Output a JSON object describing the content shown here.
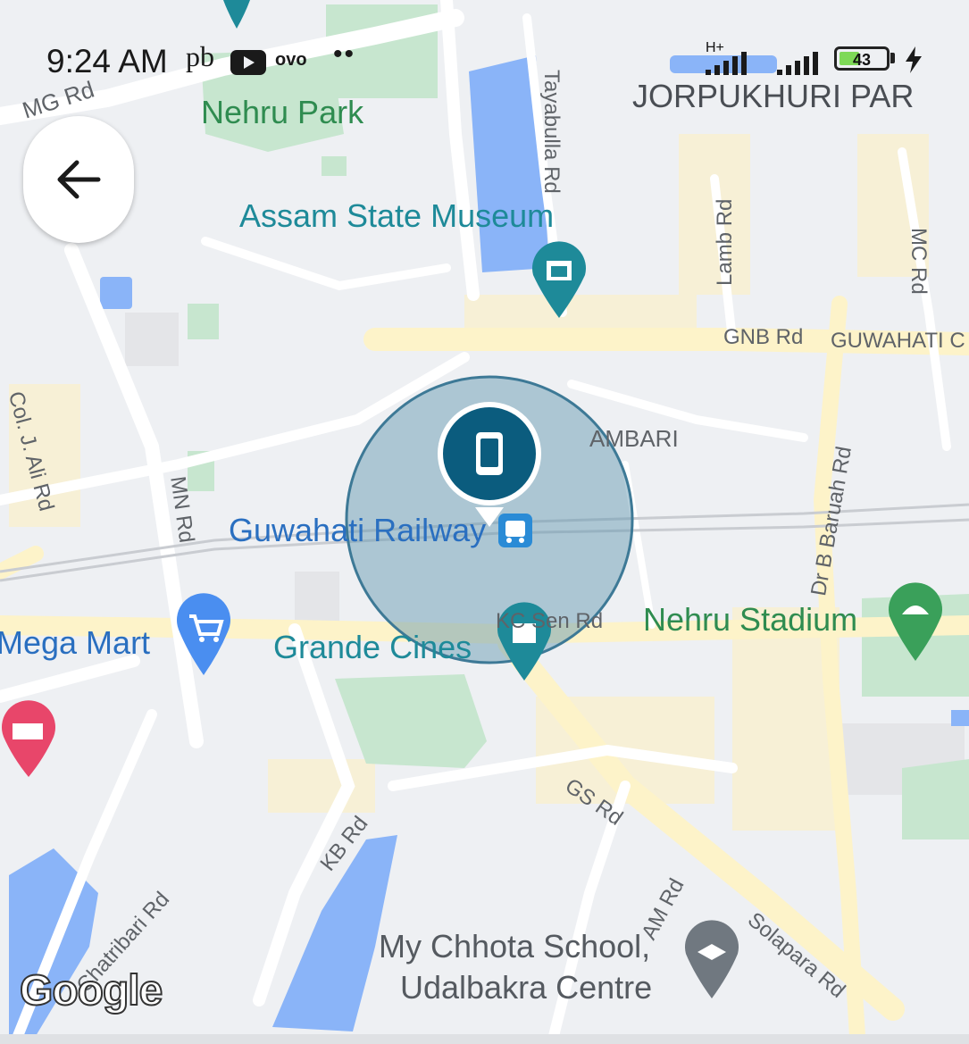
{
  "status_bar": {
    "time": "9:24 AM",
    "carrier_text": "pb",
    "ovo_label": "ovo",
    "dots": "••",
    "network_label": "H+",
    "battery_level": "43",
    "battery_fraction": 0.43,
    "icons": [
      "youtube-icon",
      "ovo-icon",
      "signal-icon",
      "battery-icon",
      "charging-icon"
    ]
  },
  "map": {
    "area_labels": {
      "jorpukhuri": "JORPUKHURI PAR",
      "ambari": "AMBARI",
      "guwahati": "GUWAHATI C"
    },
    "roads": {
      "mg": "MG Rd",
      "tayabulla": "Tayabulla Rd",
      "lamb": "Lamb Rd",
      "mc": "MC Rd",
      "gnb": "GNB Rd",
      "col_j_ali": "Col. J. Ali Rd",
      "mn": "MN Rd",
      "dr_b_baruah": "Dr B Baruah Rd",
      "kc_sen": "KC Sen Rd",
      "gs": "GS Rd",
      "kb": "KB Rd",
      "chatribari": "Chatribari Rd",
      "am": "AM Rd",
      "solapara": "Solapara Rd"
    },
    "pois": {
      "nehru_park": "Nehru Park",
      "assam_museum": "Assam State Museum",
      "railway": "Guwahati Railway",
      "mega_mart": "Mega Mart",
      "grande_cines": "Grande Cines",
      "nehru_stadium": "Nehru Stadium",
      "school_line1": "My Chhota School,",
      "school_line2": "Udalbakra Centre"
    },
    "colors": {
      "water": "#8ab4f8",
      "park": "#c7e6cf",
      "road_major": "#fdf3c9",
      "road_minor": "#ffffff",
      "accuracy_circle": "#5b93ad",
      "device_marker": "#0b5c7e",
      "poi_teal": "#1e8a99",
      "poi_green": "#3aa05a",
      "poi_blue": "#4a8ef0",
      "poi_pink": "#e8466a",
      "poi_gray": "#707880"
    },
    "attribution": "Google"
  },
  "back_button": {
    "icon": "arrow-left-icon"
  }
}
